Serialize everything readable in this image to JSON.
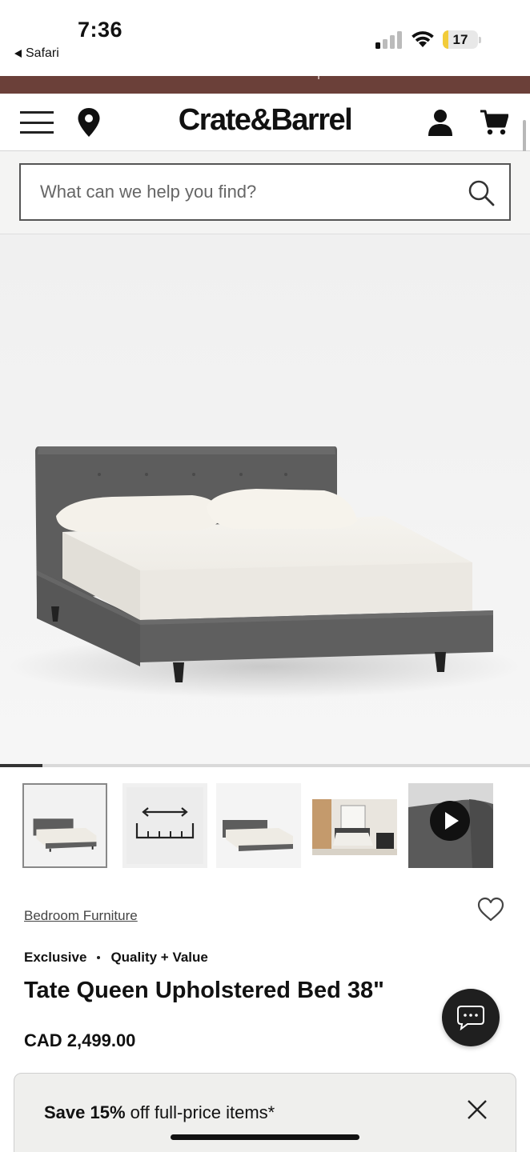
{
  "status_bar": {
    "time": "7:36",
    "back_label": "Safari",
    "battery": "17",
    "battery_level": 0.17
  },
  "header": {
    "logo": "Crate&Barrel",
    "icons": [
      "menu-icon",
      "location-pin-icon",
      "account-icon",
      "cart-icon"
    ]
  },
  "search": {
    "placeholder": "What can we help you find?"
  },
  "gallery": {
    "progress": 0.08,
    "thumbnails": [
      "bed-thumbnail",
      "dimensions-thumbnail",
      "bed-thumbnail-alt",
      "room-thumbnail",
      "video-thumbnail"
    ]
  },
  "product": {
    "breadcrumb": "Bedroom Furniture",
    "badge_1": "Exclusive",
    "badge_2": "Quality + Value",
    "title": "Tate Queen Upholstered Bed 38\"",
    "price": "CAD 2,499.00"
  },
  "promo": {
    "highlight": "Save 15%",
    "rest": "off full-price items*"
  },
  "colors": {
    "promo_strip": "#6b4039",
    "bed_fabric": "#5f5f5f",
    "text": "#111111"
  }
}
